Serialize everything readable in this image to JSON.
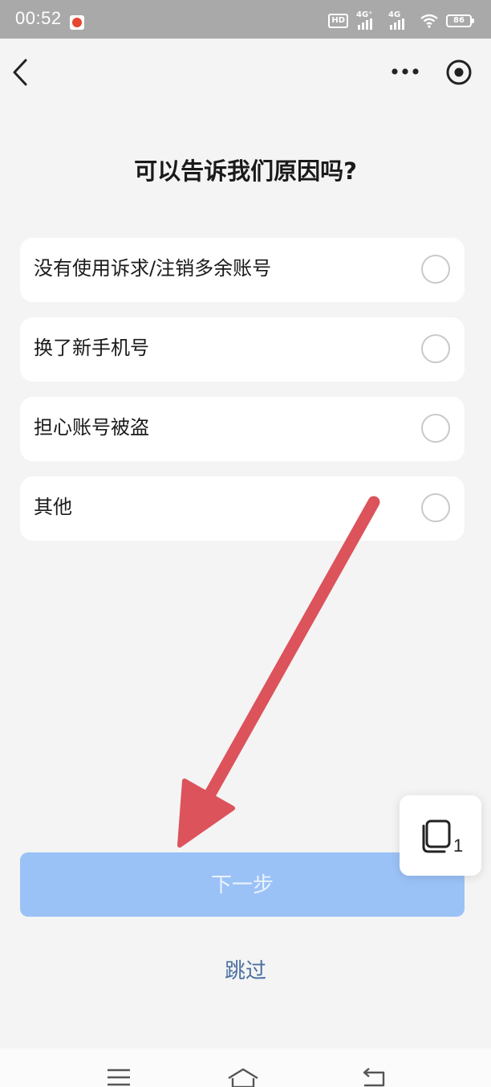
{
  "status_bar": {
    "time": "00:52",
    "hd_badge": "HD",
    "network_1": "4G⁺",
    "network_2": "4G",
    "battery": "86"
  },
  "nav": {
    "back_icon": "chevron-left-icon",
    "more_icon": "more-dots-icon",
    "target_icon": "target-icon"
  },
  "page": {
    "title": "可以告诉我们原因吗?"
  },
  "options": [
    {
      "label": "没有使用诉求/注销多余账号",
      "selected": false
    },
    {
      "label": "换了新手机号",
      "selected": false
    },
    {
      "label": "担心账号被盗",
      "selected": false
    },
    {
      "label": "其他",
      "selected": false
    }
  ],
  "floating_tabs": {
    "count": "1",
    "icon": "tabs-stack-icon"
  },
  "actions": {
    "next_label": "下一步",
    "skip_label": "跳过"
  },
  "colors": {
    "accent_button": "#9bc2f7",
    "skip_link": "#4a6fa1",
    "annotation_arrow": "#dc535b",
    "background": "#f4f4f4"
  }
}
